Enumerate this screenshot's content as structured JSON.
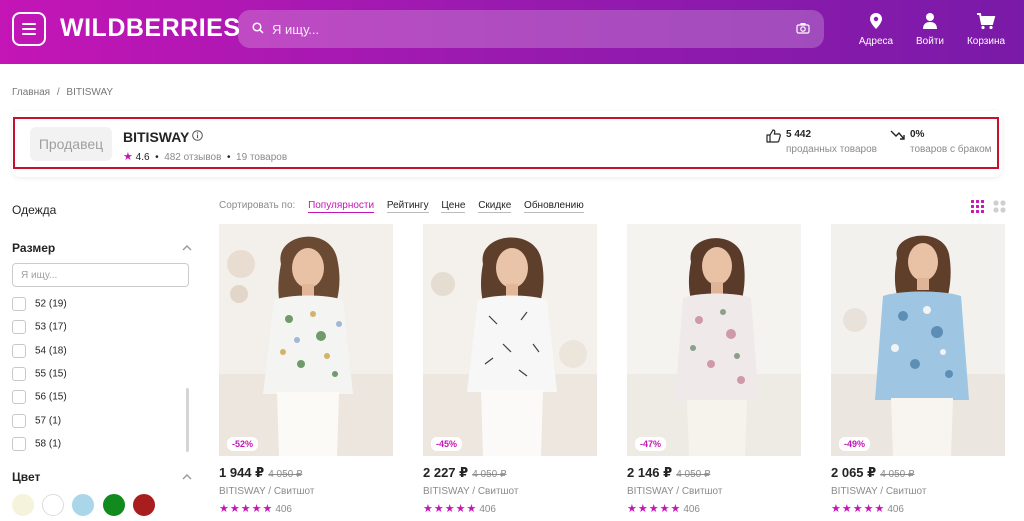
{
  "header": {
    "logo": "WILDBERRIES",
    "search_placeholder": "Я ищу...",
    "address_label": "Адреса",
    "login_label": "Войти",
    "cart_label": "Корзина",
    "gradient": [
      "#c415b6",
      "#7a1aa8"
    ]
  },
  "breadcrumbs": [
    "Главная",
    "/",
    "BITISWAY"
  ],
  "seller": {
    "logo_text": "Продавец",
    "name": "BITISWAY",
    "rating": "4.6",
    "reviews": "482 отзывов",
    "goods": "19 товаров",
    "sold_count": "5 442",
    "sold_label": "проданных товаров",
    "defect_pct": "0%",
    "defect_label": "товаров с браком"
  },
  "sidebar": {
    "category": "Одежда",
    "size_title": "Размер",
    "size_search_placeholder": "Я ищу...",
    "sizes": [
      "52 (19)",
      "53 (17)",
      "54 (18)",
      "55 (15)",
      "56 (15)",
      "57 (1)",
      "58 (1)"
    ],
    "color_title": "Цвет",
    "colors": [
      "#f6f3dc",
      "#ffffff",
      "#a9d6e8",
      "#118a1e",
      "#a81e1e"
    ]
  },
  "sort": {
    "label": "Сортировать по:",
    "options": [
      "Популярности",
      "Рейтингу",
      "Цене",
      "Скидке",
      "Обновлению"
    ],
    "active": "Популярности"
  },
  "products": [
    {
      "discount": "-52%",
      "price": "1 944 ₽",
      "old_price": "4 050 ₽",
      "brand": "BITISWAY / Свитшот",
      "stars": "★★★★★",
      "reviews": "406",
      "print": "floral-multicolor"
    },
    {
      "discount": "-45%",
      "price": "2 227 ₽",
      "old_price": "4 050 ₽",
      "brand": "BITISWAY / Свитшот",
      "stars": "★★★★★",
      "reviews": "406",
      "print": "dandelion-grey"
    },
    {
      "discount": "-47%",
      "price": "2 146 ₽",
      "old_price": "4 050 ₽",
      "brand": "BITISWAY / Свитшот",
      "stars": "★★★★★",
      "reviews": "406",
      "print": "floral-pink"
    },
    {
      "discount": "-49%",
      "price": "2 065 ₽",
      "old_price": "4 050 ₽",
      "brand": "BITISWAY / Свитшот",
      "stars": "★★★★★",
      "reviews": "406",
      "print": "floral-blue"
    }
  ]
}
